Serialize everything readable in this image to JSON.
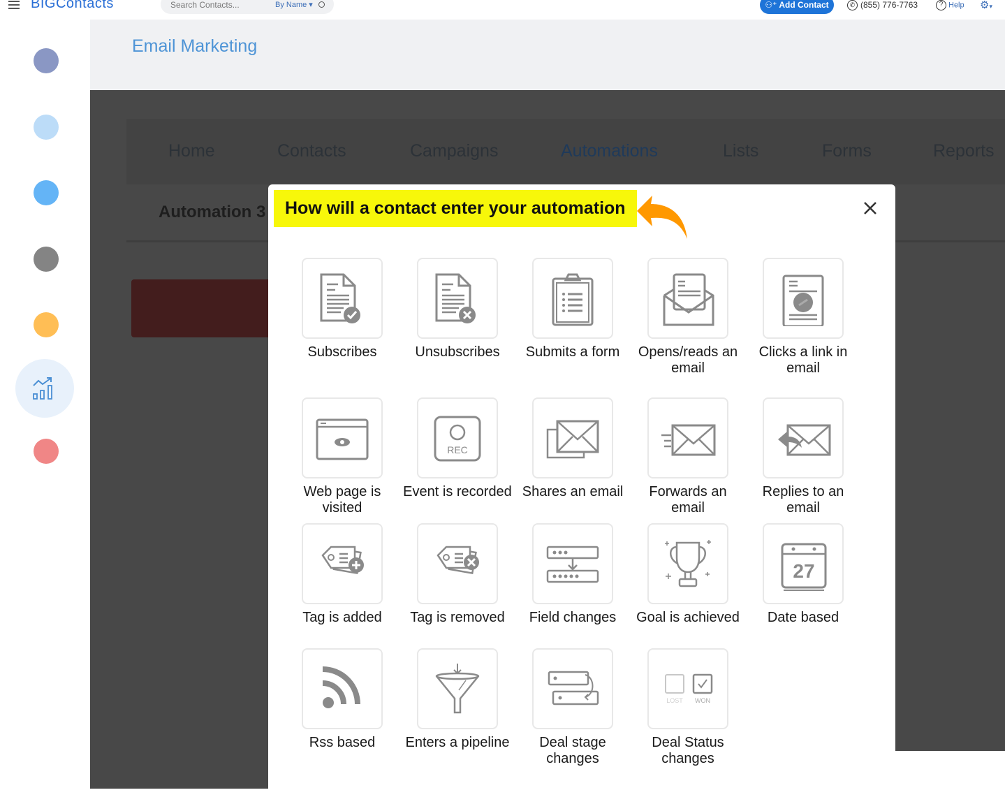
{
  "topbar": {
    "logo_text": "BIGContacts",
    "search_placeholder": "Search Contacts...",
    "search_mode": "By Name",
    "add_contact_label": "Add Contact",
    "phone": "(855) 776-7763",
    "help_label": "Help"
  },
  "sidebar": {
    "items": [
      {
        "name": "sidebar-item-1",
        "color": "#8a97c4"
      },
      {
        "name": "sidebar-item-2",
        "color": "#bcdcf8"
      },
      {
        "name": "sidebar-item-3",
        "color": "#64b4f6"
      },
      {
        "name": "sidebar-item-4",
        "color": "#848484"
      },
      {
        "name": "sidebar-item-5",
        "color": "#ffbe55"
      },
      {
        "name": "sidebar-item-reports",
        "icon": "chart-growth-icon",
        "active": true
      },
      {
        "name": "sidebar-item-7",
        "color": "#f08686"
      }
    ]
  },
  "header": {
    "title": "Email Marketing"
  },
  "nav": {
    "tabs": [
      {
        "label": "Home"
      },
      {
        "label": "Contacts"
      },
      {
        "label": "Campaigns"
      },
      {
        "label": "Automations",
        "active": true
      },
      {
        "label": "Lists"
      },
      {
        "label": "Forms"
      },
      {
        "label": "Reports"
      }
    ]
  },
  "breadcrumb": "Automation 3",
  "modal": {
    "title": "How will a contact enter your automation",
    "highlight_color": "#f7f70a",
    "arrow_color": "#ff9800",
    "triggers": [
      {
        "label": "Subscribes",
        "icon": "document-check-icon"
      },
      {
        "label": "Unsubscribes",
        "icon": "document-x-icon"
      },
      {
        "label": "Submits a form",
        "icon": "clipboard-icon"
      },
      {
        "label": "Opens/reads an email",
        "icon": "open-envelope-icon"
      },
      {
        "label": "Clicks a link in email",
        "icon": "document-link-icon"
      },
      {
        "label": "Web page is visited",
        "icon": "browser-eye-icon"
      },
      {
        "label": "Event is recorded",
        "icon": "rec-icon",
        "icon_text": "REC"
      },
      {
        "label": "Shares an email",
        "icon": "envelopes-icon"
      },
      {
        "label": "Forwards an email",
        "icon": "envelope-forward-icon"
      },
      {
        "label": "Replies to an email",
        "icon": "envelope-reply-icon"
      },
      {
        "label": "Tag is added",
        "icon": "tag-plus-icon"
      },
      {
        "label": "Tag is removed",
        "icon": "tag-x-icon"
      },
      {
        "label": "Field changes",
        "icon": "field-change-icon"
      },
      {
        "label": "Goal is achieved",
        "icon": "trophy-icon"
      },
      {
        "label": "Date based",
        "icon": "calendar-icon",
        "icon_text": "27"
      },
      {
        "label": "Rss based",
        "icon": "rss-icon"
      },
      {
        "label": "Enters a pipeline",
        "icon": "funnel-icon"
      },
      {
        "label": "Deal stage changes",
        "icon": "stage-swap-icon"
      },
      {
        "label": "Deal Status changes",
        "icon": "won-lost-icon",
        "icon_text_lost": "LOST",
        "icon_text_won": "WON"
      }
    ]
  }
}
